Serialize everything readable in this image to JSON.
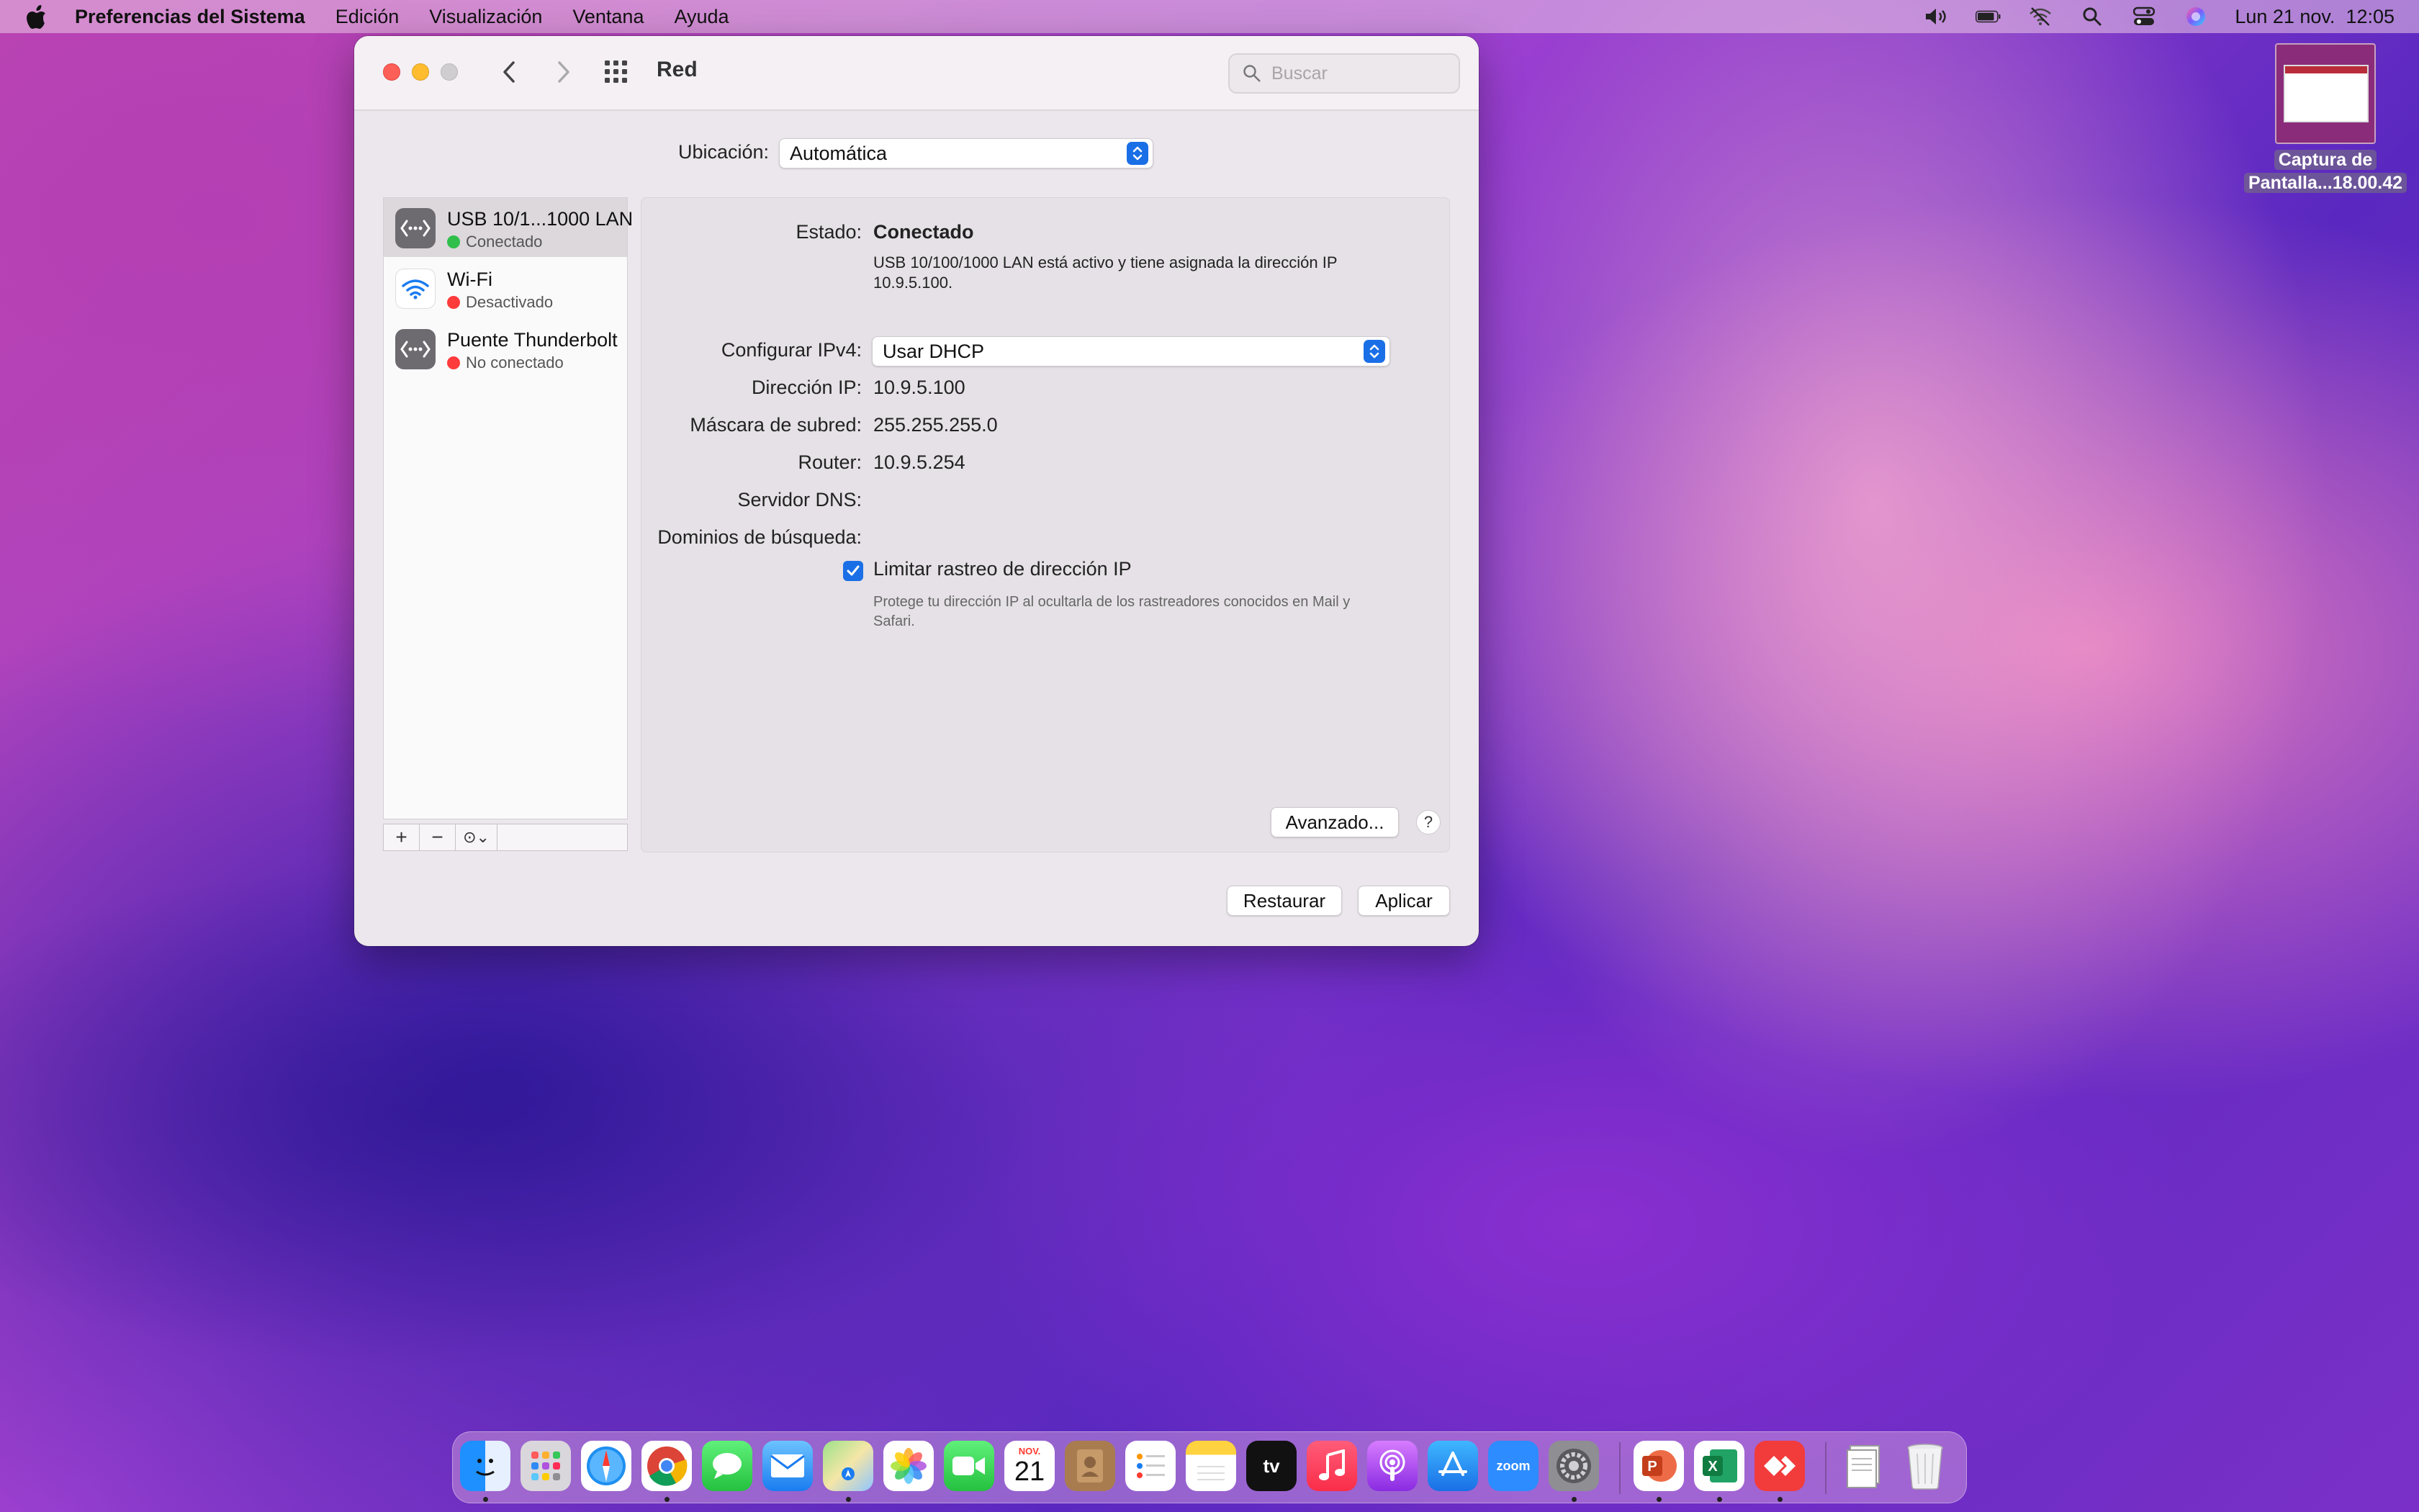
{
  "menubar": {
    "app_name": "Preferencias del Sistema",
    "items": [
      "Edición",
      "Visualización",
      "Ventana",
      "Ayuda"
    ],
    "datetime": "Lun 21 nov.  12:05"
  },
  "desktop": {
    "file_label_line1": "Captura de",
    "file_label_line2": "Pantalla...18.00.42"
  },
  "window": {
    "title": "Red",
    "search_placeholder": "Buscar",
    "location_label": "Ubicación:",
    "location_value": "Automática",
    "services": [
      {
        "name": "USB 10/1...1000 LAN",
        "status": "Conectado",
        "status_color": "#2fbf4a",
        "icon": "ethernet-icon",
        "selected": true
      },
      {
        "name": "Wi-Fi",
        "status": "Desactivado",
        "status_color": "#ff3b3b",
        "icon": "wifi-icon",
        "selected": false
      },
      {
        "name": "Puente Thunderbolt",
        "status": "No conectado",
        "status_color": "#ff3b3b",
        "icon": "thunderbolt-bridge-icon",
        "selected": false
      }
    ],
    "toolbar": {
      "add": "+",
      "remove": "−",
      "action": "⊙⌄"
    },
    "detail": {
      "status_label": "Estado:",
      "status_value": "Conectado",
      "status_description": "USB 10/100/1000 LAN está activo y tiene asignada la dirección IP 10.9.5.100.",
      "ipv4_label": "Configurar IPv4:",
      "ipv4_value": "Usar DHCP",
      "ip_label": "Dirección IP:",
      "ip_value": "10.9.5.100",
      "mask_label": "Máscara de subred:",
      "mask_value": "255.255.255.0",
      "router_label": "Router:",
      "router_value": "10.9.5.254",
      "dns_label": "Servidor DNS:",
      "search_domains_label": "Dominios de búsqueda:",
      "limit_tracking_label": "Limitar rastreo de dirección IP",
      "limit_tracking_checked": true,
      "limit_tracking_desc": "Protege tu dirección IP al ocultarla de los rastreadores conocidos en Mail y Safari.",
      "advanced_button": "Avanzado...",
      "help_button": "?"
    },
    "restore_button": "Restaurar",
    "apply_button": "Aplicar"
  },
  "dock": {
    "calendar_month": "NOV.",
    "calendar_day": "21",
    "tv_label": "tv",
    "zoom_label": "zoom",
    "excel_label": "X",
    "powerpoint_label": "P"
  },
  "colors": {
    "accent": "#1a6fe6",
    "status_green": "#2fbf4a",
    "status_red": "#ff3b3b"
  }
}
